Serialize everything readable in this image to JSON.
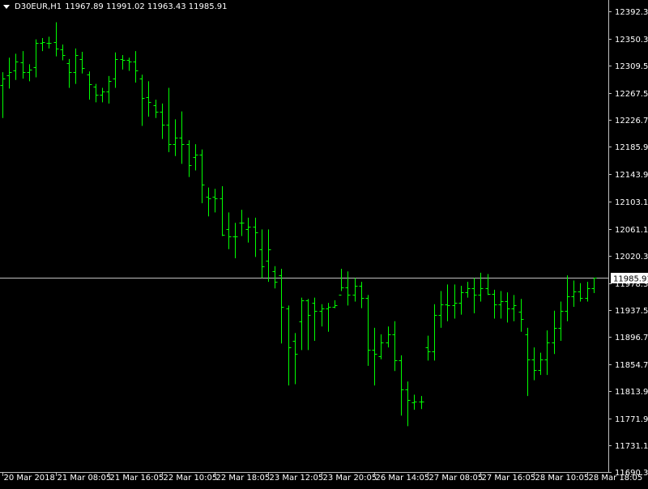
{
  "header": {
    "symbol": "D30EUR,H1",
    "ohlc": "11967.89 11991.02 11963.43 11985.91"
  },
  "colors": {
    "background": "#000000",
    "bar": "#00ff00",
    "axis": "#c0c0c0",
    "price_line": "#c0c0c0",
    "label_bg": "#ffffff",
    "label_fg": "#000000",
    "text": "#ffffff"
  },
  "chart_data": {
    "type": "ohlc",
    "ylim": [
      11690,
      12410
    ],
    "y_ticks": [
      {
        "value": 12392.3,
        "label": "12392.30"
      },
      {
        "value": 12350.3,
        "label": "12350.30"
      },
      {
        "value": 12309.5,
        "label": "12309.50"
      },
      {
        "value": 12267.5,
        "label": "12267.50"
      },
      {
        "value": 12226.7,
        "label": "12226.70"
      },
      {
        "value": 12185.9,
        "label": "12185.90"
      },
      {
        "value": 12143.9,
        "label": "12143.90"
      },
      {
        "value": 12103.1,
        "label": "12103.10"
      },
      {
        "value": 12061.1,
        "label": "12061.10"
      },
      {
        "value": 12020.3,
        "label": "12020.30"
      },
      {
        "value": 11978.3,
        "label": "11978.30"
      },
      {
        "value": 11937.5,
        "label": "11937.50"
      },
      {
        "value": 11896.7,
        "label": "11896.70"
      },
      {
        "value": 11854.7,
        "label": "11854.70"
      },
      {
        "value": 11813.9,
        "label": "11813.90"
      },
      {
        "value": 11771.9,
        "label": "11771.90"
      },
      {
        "value": 11731.1,
        "label": "11731.10"
      },
      {
        "value": 11690.3,
        "label": "11690.30"
      }
    ],
    "x_ticks": [
      {
        "index": 0,
        "label": "20 Mar 2018"
      },
      {
        "index": 8,
        "label": "21 Mar 08:05"
      },
      {
        "index": 16,
        "label": "21 Mar 16:05"
      },
      {
        "index": 24,
        "label": "22 Mar 10:05"
      },
      {
        "index": 32,
        "label": "22 Mar 18:05"
      },
      {
        "index": 40,
        "label": "23 Mar 12:05"
      },
      {
        "index": 48,
        "label": "23 Mar 20:05"
      },
      {
        "index": 56,
        "label": "26 Mar 14:05"
      },
      {
        "index": 64,
        "label": "27 Mar 08:05"
      },
      {
        "index": 72,
        "label": "27 Mar 16:05"
      },
      {
        "index": 80,
        "label": "28 Mar 10:05"
      },
      {
        "index": 88,
        "label": "28 Mar 18:05"
      }
    ],
    "current_price": {
      "value": 11985.91,
      "label": "11985.91"
    },
    "bars": [
      [
        12280,
        12300,
        12230,
        12290
      ],
      [
        12295,
        12322,
        12275,
        12300
      ],
      [
        12302,
        12328,
        12288,
        12316
      ],
      [
        12315,
        12332,
        12290,
        12300
      ],
      [
        12300,
        12312,
        12286,
        12304
      ],
      [
        12308,
        12350,
        12292,
        12344
      ],
      [
        12344,
        12352,
        12332,
        12346
      ],
      [
        12345,
        12354,
        12336,
        12345
      ],
      [
        12346,
        12376,
        12324,
        12336
      ],
      [
        12335,
        12342,
        12318,
        12326
      ],
      [
        12314,
        12320,
        12276,
        12300
      ],
      [
        12300,
        12336,
        12282,
        12326
      ],
      [
        12320,
        12331,
        12298,
        12306
      ],
      [
        12296,
        12301,
        12258,
        12282
      ],
      [
        12278,
        12282,
        12254,
        12266
      ],
      [
        12266,
        12276,
        12254,
        12270
      ],
      [
        12270,
        12294,
        12252,
        12286
      ],
      [
        12290,
        12330,
        12276,
        12320
      ],
      [
        12320,
        12326,
        12304,
        12318
      ],
      [
        12318,
        12322,
        12302,
        12316
      ],
      [
        12316,
        12332,
        12284,
        12302
      ],
      [
        12290,
        12296,
        12218,
        12260
      ],
      [
        12262,
        12286,
        12232,
        12254
      ],
      [
        12250,
        12258,
        12230,
        12240
      ],
      [
        12240,
        12252,
        12198,
        12220
      ],
      [
        12220,
        12276,
        12178,
        12190
      ],
      [
        12190,
        12228,
        12172,
        12200
      ],
      [
        12200,
        12240,
        12160,
        12190
      ],
      [
        12190,
        12196,
        12140,
        12158
      ],
      [
        12170,
        12190,
        12150,
        12174
      ],
      [
        12174,
        12182,
        12100,
        12128
      ],
      [
        12110,
        12124,
        12080,
        12108
      ],
      [
        12110,
        12122,
        12086,
        12108
      ],
      [
        12108,
        12126,
        12050,
        12052
      ],
      [
        12060,
        12086,
        12030,
        12050
      ],
      [
        12050,
        12070,
        12016,
        12050
      ],
      [
        12070,
        12090,
        12050,
        12070
      ],
      [
        12060,
        12078,
        12040,
        12064
      ],
      [
        12064,
        12078,
        12018,
        12056
      ],
      [
        12030,
        12060,
        11986,
        12004
      ],
      [
        12012,
        12060,
        11980,
        12030
      ],
      [
        11996,
        12004,
        11970,
        11980
      ],
      [
        11990,
        12000,
        11886,
        11942
      ],
      [
        11940,
        11944,
        11822,
        11880
      ],
      [
        11890,
        11902,
        11824,
        11870
      ],
      [
        11920,
        11956,
        11876,
        11952
      ],
      [
        11952,
        11954,
        11876,
        11930
      ],
      [
        11948,
        11956,
        11890,
        11936
      ],
      [
        11936,
        11946,
        11912,
        11940
      ],
      [
        11940,
        11948,
        11904,
        11942
      ],
      [
        11942,
        11952,
        11940,
        11944
      ],
      [
        11960,
        12000,
        11966,
        11972
      ],
      [
        11972,
        11996,
        11944,
        11960
      ],
      [
        11960,
        11986,
        11950,
        11974
      ],
      [
        11974,
        11980,
        11940,
        11956
      ],
      [
        11956,
        11960,
        11852,
        11876
      ],
      [
        11876,
        11910,
        11822,
        11870
      ],
      [
        11866,
        11900,
        11862,
        11888
      ],
      [
        11888,
        11912,
        11880,
        11900
      ],
      [
        11900,
        11920,
        11844,
        11860
      ],
      [
        11860,
        11868,
        11776,
        11816
      ],
      [
        11816,
        11828,
        11760,
        11800
      ],
      [
        11796,
        11808,
        11785,
        11798
      ],
      [
        11798,
        11806,
        11786,
        11797
      ],
      [
        11880,
        11898,
        11860,
        11874
      ],
      [
        11874,
        11946,
        11860,
        11930
      ],
      [
        11930,
        11966,
        11910,
        11946
      ],
      [
        11946,
        11976,
        11920,
        11944
      ],
      [
        11944,
        11976,
        11924,
        11948
      ],
      [
        11948,
        11974,
        11930,
        11964
      ],
      [
        11964,
        11980,
        11956,
        11970
      ],
      [
        11970,
        11986,
        11932,
        11960
      ],
      [
        11960,
        11994,
        11950,
        11970
      ],
      [
        11970,
        11992,
        11960,
        11962
      ],
      [
        11962,
        11968,
        11924,
        11946
      ],
      [
        11946,
        11966,
        11924,
        11950
      ],
      [
        11950,
        11964,
        11918,
        11940
      ],
      [
        11940,
        11960,
        11920,
        11944
      ],
      [
        11934,
        11954,
        11904,
        11924
      ],
      [
        11900,
        11910,
        11806,
        11862
      ],
      [
        11862,
        11880,
        11830,
        11846
      ],
      [
        11846,
        11872,
        11838,
        11862
      ],
      [
        11862,
        11906,
        11838,
        11888
      ],
      [
        11888,
        11936,
        11870,
        11910
      ],
      [
        11910,
        11950,
        11890,
        11936
      ],
      [
        11936,
        11990,
        11920,
        11958
      ],
      [
        11958,
        11982,
        11942,
        11966
      ],
      [
        11966,
        11978,
        11950,
        11956
      ],
      [
        11956,
        11980,
        11950,
        11970
      ],
      [
        11970,
        11986,
        11963,
        11986
      ]
    ]
  }
}
